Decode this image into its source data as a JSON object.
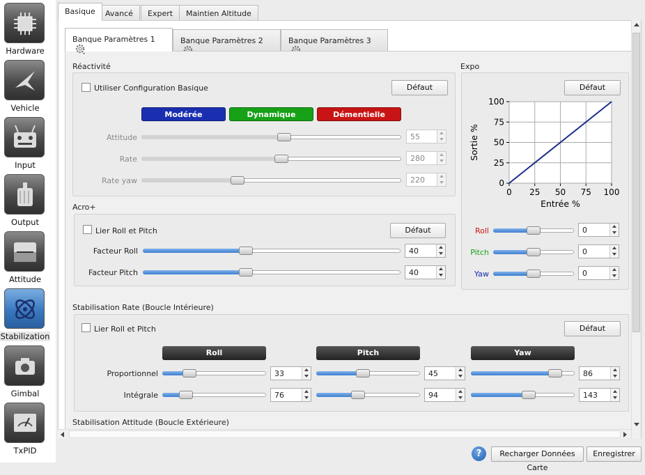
{
  "sidebar": {
    "items": [
      {
        "label": "Hardware",
        "icon": "chip-icon"
      },
      {
        "label": "Vehicle",
        "icon": "aircraft-icon"
      },
      {
        "label": "Input",
        "icon": "transmitter-icon"
      },
      {
        "label": "Output",
        "icon": "motor-icon"
      },
      {
        "label": "Attitude",
        "icon": "horizon-icon"
      },
      {
        "label": "Stabilization",
        "icon": "gyro-icon"
      },
      {
        "label": "Gimbal",
        "icon": "camera-icon"
      },
      {
        "label": "TxPID",
        "icon": "meter-icon"
      }
    ]
  },
  "tabs": [
    "Basique",
    "Avancé",
    "Expert",
    "Maintien Altitude"
  ],
  "banks": [
    "Banque Paramètres 1",
    "Banque Paramètres 2",
    "Banque Paramètres 3"
  ],
  "reactivite": {
    "title": "Réactivité",
    "checkbox": "Utiliser Configuration Basique",
    "default_label": "Défaut",
    "presets": [
      {
        "label": "Modérée",
        "color": "#1a2fb0"
      },
      {
        "label": "Dynamique",
        "color": "#17a117"
      },
      {
        "label": "Démentielle",
        "color": "#c81414"
      }
    ],
    "rows": [
      {
        "label": "Attitude",
        "value": "55",
        "level": 0.55
      },
      {
        "label": "Rate",
        "value": "280",
        "level": 0.54
      },
      {
        "label": "Rate yaw",
        "value": "220",
        "level": 0.37
      }
    ]
  },
  "acro": {
    "title": "Acro+",
    "checkbox": "Lier Roll et Pitch",
    "default_label": "Défaut",
    "rows": [
      {
        "label": "Facteur Roll",
        "value": "40",
        "level": 0.4
      },
      {
        "label": "Facteur Pitch",
        "value": "40",
        "level": 0.4
      }
    ]
  },
  "expo": {
    "title": "Expo",
    "default_label": "Défaut",
    "rows": [
      {
        "label": "Roll",
        "value": "0",
        "color": "#c81414",
        "level": 0.5
      },
      {
        "label": "Pitch",
        "value": "0",
        "color": "#17a117",
        "level": 0.5
      },
      {
        "label": "Yaw",
        "value": "0",
        "color": "#1a2fb0",
        "level": 0.5
      }
    ]
  },
  "chart_data": {
    "type": "line",
    "xlabel": "Entrée %",
    "ylabel": "Sortie %",
    "xlim": [
      0,
      100
    ],
    "ylim": [
      0,
      100
    ],
    "xticks": [
      "0",
      "25",
      "50",
      "75",
      "100"
    ],
    "yticks": [
      "0",
      "25",
      "50",
      "75",
      "100"
    ],
    "grid": true,
    "series": [
      {
        "x": [
          0,
          100
        ],
        "y": [
          0,
          100
        ],
        "color": "#1a2f8a"
      }
    ]
  },
  "rate": {
    "title": "Stabilisation Rate (Boucle Intérieure)",
    "checkbox": "Lier Roll et Pitch",
    "default_label": "Défaut",
    "headers": [
      "Roll",
      "Pitch",
      "Yaw"
    ],
    "rows": [
      {
        "label": "Proportionnel",
        "cells": [
          {
            "value": "33",
            "level": 0.26
          },
          {
            "value": "45",
            "level": 0.45
          },
          {
            "value": "86",
            "level": 0.81
          }
        ]
      },
      {
        "label": "Intégrale",
        "cells": [
          {
            "value": "76",
            "level": 0.23
          },
          {
            "value": "94",
            "level": 0.4
          },
          {
            "value": "143",
            "level": 0.56
          }
        ]
      }
    ]
  },
  "attitude_title": "Stabilisation Attitude (Boucle Extérieure)",
  "footer": {
    "reload": "Recharger Données Carte",
    "save": "Enregistrer"
  }
}
